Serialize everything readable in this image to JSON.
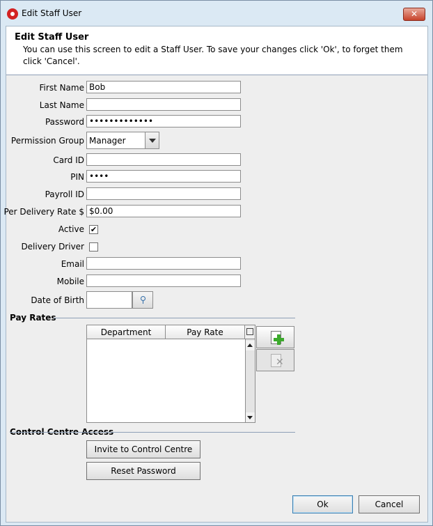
{
  "window": {
    "title": "Edit Staff User",
    "close_label": "✕"
  },
  "banner": {
    "title": "Edit Staff User",
    "description": "You can use this screen to edit a Staff User. To save your changes click 'Ok', to forget them click 'Cancel'."
  },
  "form": {
    "first_name": {
      "label": "First Name",
      "value": "Bob"
    },
    "last_name": {
      "label": "Last Name",
      "value": ""
    },
    "password": {
      "label": "Password",
      "value": "•••••••••••••"
    },
    "permission_group": {
      "label": "Permission Group",
      "value": "Manager"
    },
    "card_id": {
      "label": "Card ID",
      "value": ""
    },
    "pin": {
      "label": "PIN",
      "value": "••••"
    },
    "payroll_id": {
      "label": "Payroll ID",
      "value": ""
    },
    "per_delivery_rate": {
      "label": "Per Delivery Rate $",
      "value": "$0.00"
    },
    "active": {
      "label": "Active",
      "checked": true,
      "mark": "✔"
    },
    "delivery_driver": {
      "label": "Delivery Driver",
      "checked": false,
      "mark": ""
    },
    "email": {
      "label": "Email",
      "value": ""
    },
    "mobile": {
      "label": "Mobile",
      "value": ""
    },
    "date_of_birth": {
      "label": "Date of Birth",
      "value": ""
    }
  },
  "pay_rates": {
    "section_title": "Pay Rates",
    "columns": [
      "Department",
      "Pay Rate"
    ],
    "rows": []
  },
  "control_centre": {
    "section_title": "Control Centre Access",
    "invite_label": "Invite to Control Centre",
    "reset_label": "Reset Password"
  },
  "footer": {
    "ok_label": "Ok",
    "cancel_label": "Cancel"
  },
  "icons": {
    "app": "app-logo-icon",
    "add": "add-document-icon",
    "delete": "delete-document-icon",
    "calendar": "calendar-pin-icon"
  }
}
